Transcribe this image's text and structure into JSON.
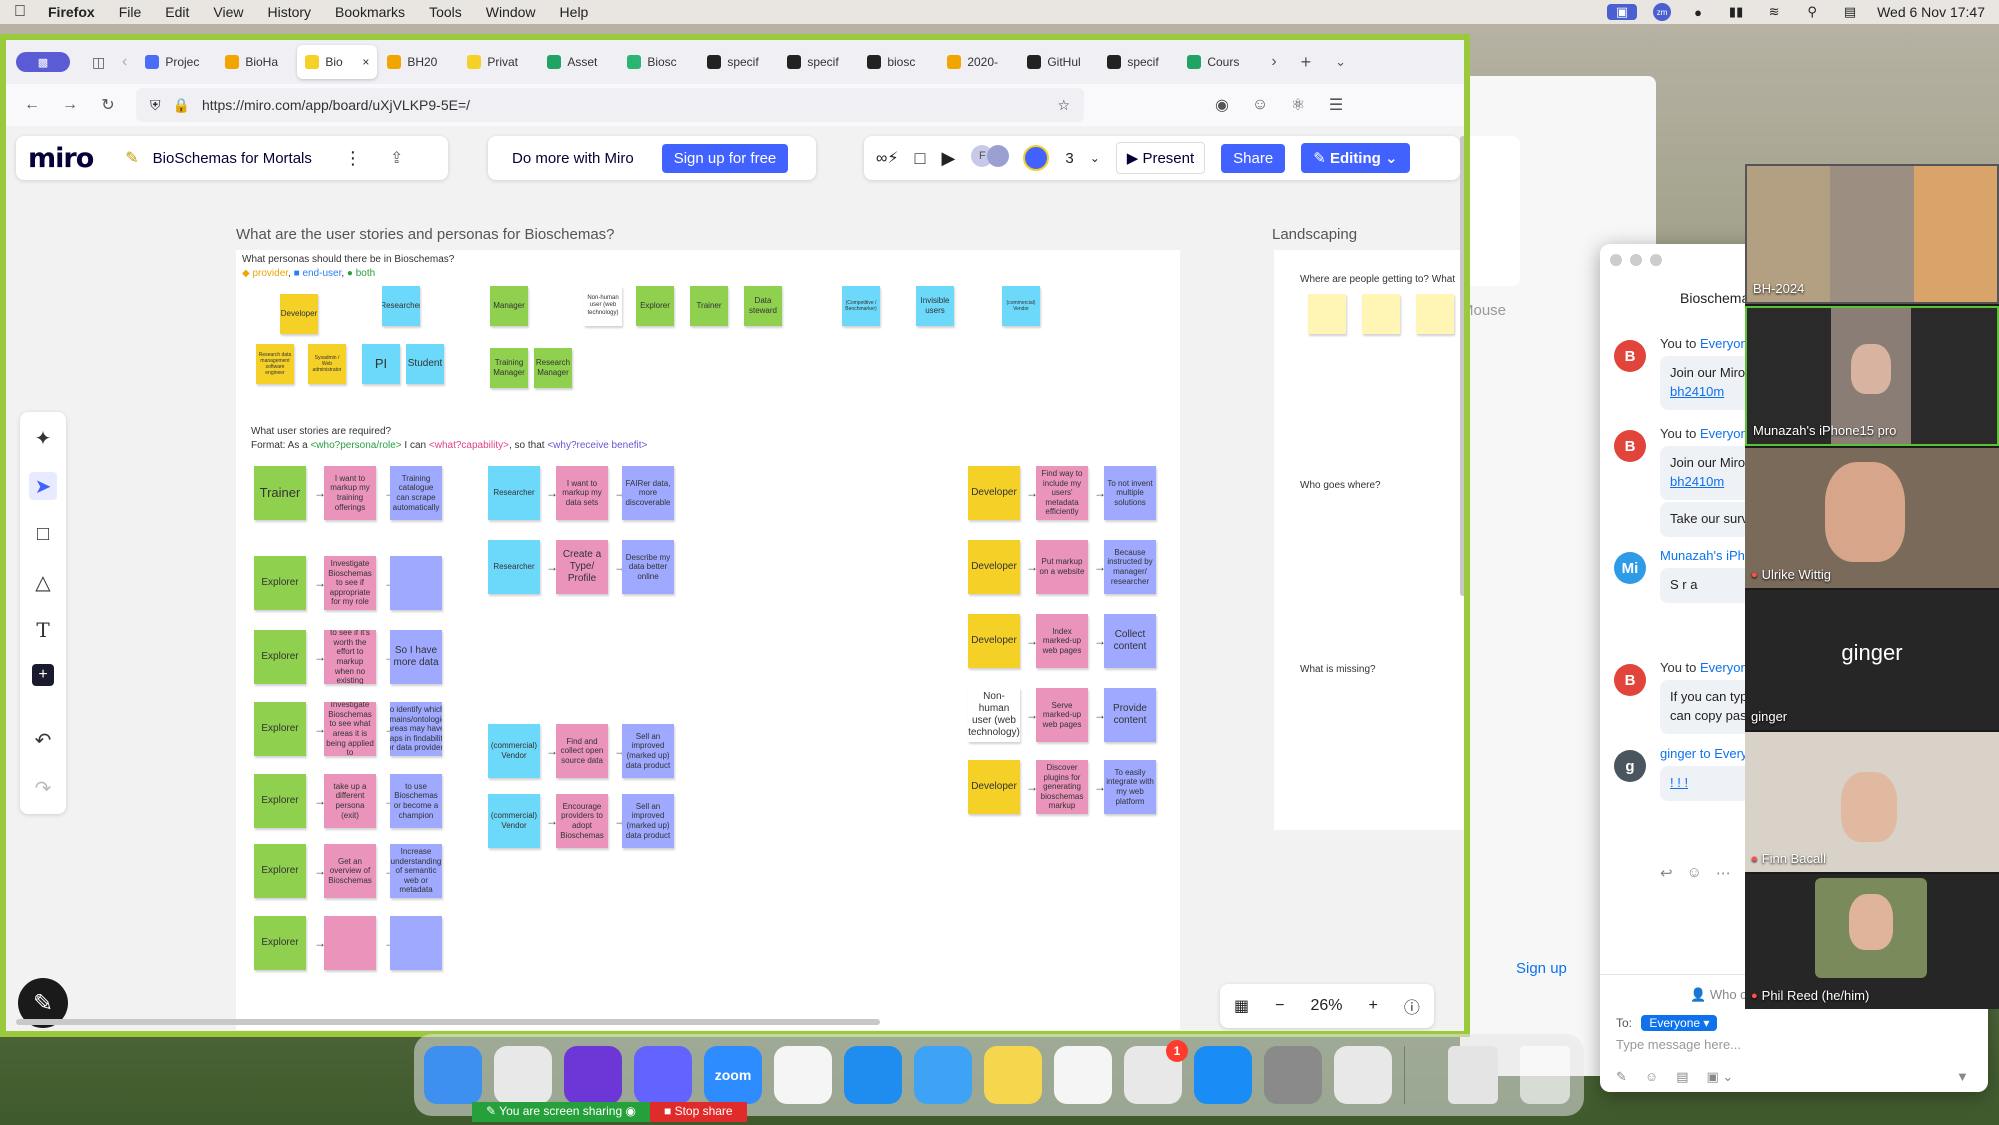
{
  "menubar": {
    "app": "Firefox",
    "items": [
      "File",
      "Edit",
      "View",
      "History",
      "Bookmarks",
      "Tools",
      "Window",
      "Help"
    ],
    "datetime": "Wed 6 Nov  17:47"
  },
  "browser": {
    "tabs": [
      {
        "label": "Projec",
        "color": "#4a6cf7"
      },
      {
        "label": "BioHa",
        "color": "#f0a500"
      },
      {
        "label": "Bio",
        "color": "#f5d128",
        "active": true
      },
      {
        "label": "BH20",
        "color": "#f0a500"
      },
      {
        "label": "Privat",
        "color": "#f5d128"
      },
      {
        "label": "Asset",
        "color": "#21a366"
      },
      {
        "label": "Biosc",
        "color": "#2ab573"
      },
      {
        "label": "specif",
        "color": "#222"
      },
      {
        "label": "specif",
        "color": "#222"
      },
      {
        "label": "biosc",
        "color": "#222"
      },
      {
        "label": "2020-",
        "color": "#f0a500"
      },
      {
        "label": "GitHul",
        "color": "#222"
      },
      {
        "label": "specif",
        "color": "#222"
      },
      {
        "label": "Cours",
        "color": "#21a366"
      }
    ],
    "url": "https://miro.com/app/board/uXjVLKP9-5E=/"
  },
  "miro": {
    "logo": "miro",
    "board_name": "BioSchemas for Mortals",
    "do_more": "Do more with Miro",
    "signup": "Sign up for free",
    "user_count": "3",
    "present": "Present",
    "share": "Share",
    "editing": "Editing",
    "zoom": "26%"
  },
  "board": {
    "frame1_title": "What are the user stories and personas for Bioschemas?",
    "frame2_title": "Landscaping",
    "personas_q": "What personas should there be in Bioschemas?",
    "legend": {
      "provider": "provider",
      "end_user": "end-user",
      "both": "both"
    },
    "stories_q": "What user stories are required?",
    "format_prefix": "Format: As a ",
    "format_who": "<who?persona/role>",
    "format_mid1": " I can ",
    "format_what": "<what?capability>",
    "format_mid2": ", so that ",
    "format_why": "<why?receive benefit>",
    "persona_notes": {
      "developer": "Developer",
      "researcher": "Researcher",
      "manager": "Manager",
      "nonhuman": "Non-human user (web technology)",
      "explorer": "Explorer",
      "trainer": "Trainer",
      "steward": "Data steward",
      "commercial": "(Competitive / Benchmarker)",
      "invisible": "Invisible users",
      "vendor": "(commercial) Vendor",
      "dataset_mgmt": "Research data management software engineer",
      "sysadmin": "Sysadmin / Web administrator",
      "pi": "PI",
      "student": "Student",
      "training_manager": "Training Manager",
      "research_manager": "Research Manager"
    },
    "stories_left": [
      {
        "role": "Trainer",
        "cap": "I want to markup my training offerings",
        "why": "Training catalogue can scrape automatically"
      },
      {
        "role": "Explorer",
        "cap": "Investigate Bioschemas to see if appropriate for my role",
        "why": ""
      },
      {
        "role": "Explorer",
        "cap": "Investigate Bioschemas to see if it's worth the effort to markup when no existing resources in my domain",
        "why": "So I have more data"
      },
      {
        "role": "Explorer",
        "cap": "Investigate Bioschemas to see what areas it is being applied to",
        "why": "to identify which domains/ontological areas may have gaps in findability for data providers"
      },
      {
        "role": "Explorer",
        "cap": "take up a different persona (exit)",
        "why": "to use Bioschemas or become a champion"
      },
      {
        "role": "Explorer",
        "cap": "Get an overview of Bioschemas",
        "why": "Increase understanding of semantic web or metadata"
      },
      {
        "role": "Explorer",
        "cap": "",
        "why": ""
      }
    ],
    "stories_mid": [
      {
        "role": "Researcher",
        "cap": "I want to markup my data sets",
        "why": "FAIRer data, more discoverable"
      },
      {
        "role": "Researcher",
        "cap": "Create a Type/ Profile",
        "why": "Describe my data better online"
      },
      {
        "role": "(commercial) Vendor",
        "cap": "Find and collect open source data",
        "why": "Sell an improved (marked up) data product"
      },
      {
        "role": "(commercial) Vendor",
        "cap": "Encourage providers to adopt Bioschemas",
        "why": "Sell an improved (marked up) data product"
      }
    ],
    "stories_right": [
      {
        "role": "Developer",
        "cap": "Find way to include my users' metadata efficiently",
        "why": "To not invent multiple solutions"
      },
      {
        "role": "Developer",
        "cap": "Put markup on a website",
        "why": "Because instructed by manager/ researcher"
      },
      {
        "role": "Developer",
        "cap": "Index marked-up web pages",
        "why": "Collect content"
      },
      {
        "role": "Non-human user (web technology)",
        "cap": "Serve marked-up web pages",
        "why": "Provide content"
      },
      {
        "role": "Developer",
        "cap": "Discover plugins for generating bioschemas markup",
        "why": "To easily integrate with my web platform"
      }
    ],
    "landscape_q1": "Where are people getting to? What",
    "landscape_q2": "Who goes where?",
    "landscape_q3": "What is missing?"
  },
  "chat": {
    "title": "Bioschema",
    "messages": [
      {
        "avatar": "B",
        "color": "#e0443a",
        "who": "You to ",
        "to": "Everyon",
        "text1": "Join our Miro",
        "link": "bh2410m"
      },
      {
        "avatar": "B",
        "color": "#e0443a",
        "who": "You to ",
        "to": "Everyon",
        "text1": "Join our Miro",
        "link": "bh2410m"
      },
      {
        "avatar": "",
        "color": "",
        "who": "",
        "to": "",
        "text1": "Take our surv",
        "link": ""
      },
      {
        "avatar": "Mi",
        "color": "#2e9be6",
        "who": "",
        "to": "Munazah's iPh",
        "text1": "S r a",
        "link": ""
      },
      {
        "avatar": "B",
        "color": "#e0443a",
        "who": "You to ",
        "to": "Everyon",
        "text1": "If you can typ can copy pas",
        "link": ""
      },
      {
        "avatar": "g",
        "color": "#4a5560",
        "who": "",
        "to": "ginger to Every",
        "text1": "",
        "link": "! ! !"
      }
    ],
    "who_label": "Who c",
    "to_label": "To:",
    "to_value": "Everyone",
    "placeholder": "Type message here..."
  },
  "background": {
    "mouse_label": "Mouse",
    "signup_link": "Sign up"
  },
  "gallery": {
    "tiles": [
      {
        "name": "BH-2024"
      },
      {
        "name": "Munazah's iPhone15 pro"
      },
      {
        "name": "Ulrike Wittig"
      },
      {
        "name": "ginger",
        "center": "ginger"
      },
      {
        "name": "Finn Bacall"
      },
      {
        "name": "Phil Reed (he/him)"
      }
    ]
  },
  "dock": {
    "apps": [
      {
        "name": "finder-icon",
        "color": "#3d8ff0"
      },
      {
        "name": "chrome-icon",
        "color": "#e8e8e8"
      },
      {
        "name": "firefox-icon",
        "color": "#6d37d8"
      },
      {
        "name": "mastodon-icon",
        "color": "#6364ff"
      },
      {
        "name": "zoom-icon",
        "color": "#2d8cff",
        "label": "zoom"
      },
      {
        "name": "slack-icon",
        "color": "#f5f5f5"
      },
      {
        "name": "safari-icon",
        "color": "#1f8cf0"
      },
      {
        "name": "mail-icon",
        "color": "#3fa3f5"
      },
      {
        "name": "notes-icon",
        "color": "#f5d64c"
      },
      {
        "name": "freeform-icon",
        "color": "#f5f5f5"
      },
      {
        "name": "toolbox-icon",
        "color": "#e8e8e8",
        "badge": "1"
      },
      {
        "name": "appstore-icon",
        "color": "#1a8cf5"
      },
      {
        "name": "settings-icon",
        "color": "#8a8a8a"
      },
      {
        "name": "launchpad-icon",
        "color": "#e8e8e8"
      }
    ]
  },
  "sharebar": {
    "sharing": "You are screen sharing",
    "stop": "Stop share"
  }
}
